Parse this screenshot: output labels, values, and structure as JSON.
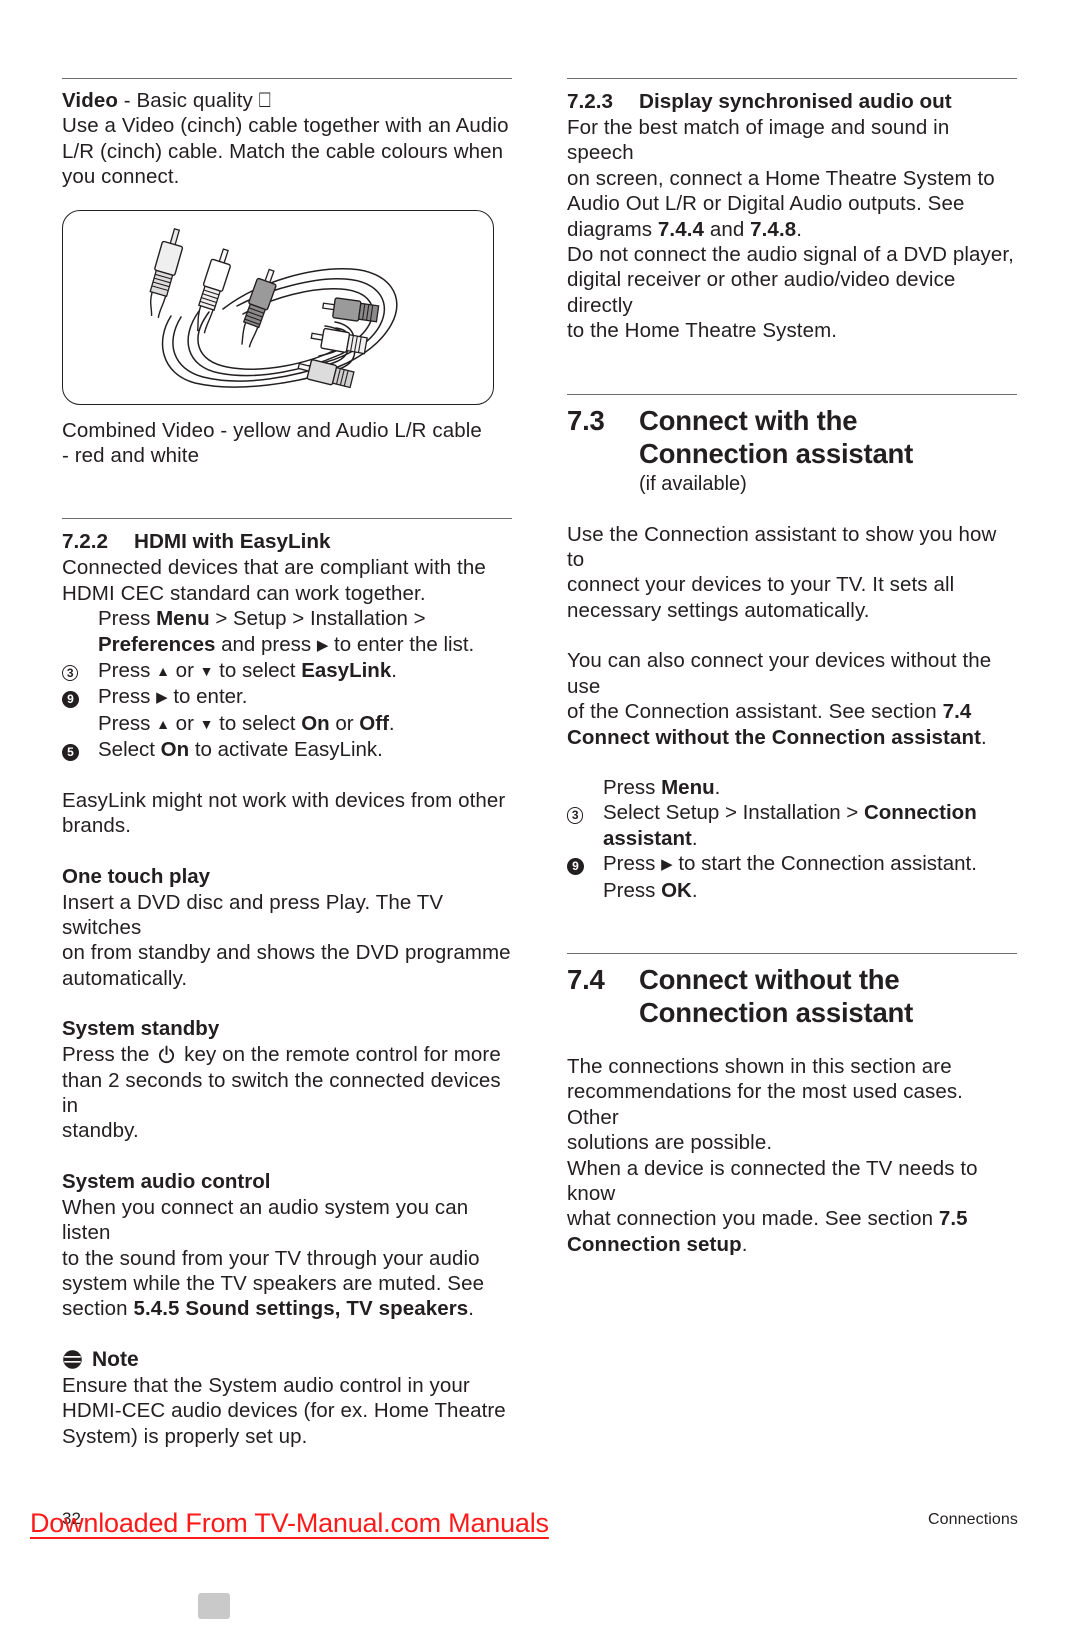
{
  "document": {
    "page_number": "32",
    "footer_right": "Connections",
    "watermark": "Downloaded From TV-Manual.com Manuals",
    "watermark_color": "#ff1a1a"
  },
  "left_column": {
    "video_block": {
      "heading_bold": "Video",
      "heading_rest": " - Basic quality",
      "heading_glyph": "⎕",
      "body": [
        "Use a Video (cinch) cable together with an Audio",
        "L/R (cinch) cable. Match the cable colours when",
        "you connect."
      ],
      "illustration_name": "composite-av-cable",
      "caption": [
        "Combined Video - yellow and Audio L/R cable",
        "- red and white"
      ]
    },
    "hdmi_easylink": {
      "section_number": "7.2.2",
      "section_title": "HDMI with EasyLink",
      "intro": [
        "Connected devices that are compliant with the",
        "HDMI CEC standard can work together."
      ],
      "steps": [
        {
          "marker": "",
          "marker_style": "none",
          "lines": [
            {
              "parts": [
                {
                  "t": "Press ",
                  "b": false
                },
                {
                  "t": "Menu",
                  "b": true
                },
                {
                  "t": " > Setup > Installation >",
                  "b": false
                }
              ]
            },
            {
              "parts": [
                {
                  "t": "Preferences",
                  "b": true
                },
                {
                  "t": " and press ",
                  "b": false
                },
                {
                  "t": "▶",
                  "b": false,
                  "icon": "arrow-right"
                },
                {
                  "t": " to enter the list.",
                  "b": false
                }
              ]
            }
          ]
        },
        {
          "marker": "3",
          "marker_style": "open",
          "lines": [
            {
              "parts": [
                {
                  "t": "Press ",
                  "b": false
                },
                {
                  "t": "▲",
                  "b": false,
                  "icon": "arrow-up"
                },
                {
                  "t": " or ",
                  "b": false
                },
                {
                  "t": "▼",
                  "b": false,
                  "icon": "arrow-down"
                },
                {
                  "t": " to select ",
                  "b": false
                },
                {
                  "t": "EasyLink",
                  "b": true
                },
                {
                  "t": ".",
                  "b": false
                }
              ]
            }
          ]
        },
        {
          "marker": "9",
          "marker_style": "solid",
          "lines": [
            {
              "parts": [
                {
                  "t": "Press ",
                  "b": false
                },
                {
                  "t": "▶",
                  "b": false,
                  "icon": "arrow-right"
                },
                {
                  "t": " to enter.",
                  "b": false
                }
              ]
            },
            {
              "parts": [
                {
                  "t": "Press ",
                  "b": false
                },
                {
                  "t": "▲",
                  "b": false,
                  "icon": "arrow-up"
                },
                {
                  "t": " or ",
                  "b": false
                },
                {
                  "t": "▼",
                  "b": false,
                  "icon": "arrow-down"
                },
                {
                  "t": " to select ",
                  "b": false
                },
                {
                  "t": "On",
                  "b": true
                },
                {
                  "t": " or ",
                  "b": false
                },
                {
                  "t": "Off",
                  "b": true
                },
                {
                  "t": ".",
                  "b": false
                }
              ]
            }
          ]
        },
        {
          "marker": "5",
          "marker_style": "solid",
          "lines": [
            {
              "parts": [
                {
                  "t": "Select ",
                  "b": false
                },
                {
                  "t": "On",
                  "b": true
                },
                {
                  "t": " to activate EasyLink.",
                  "b": false
                }
              ]
            }
          ]
        }
      ],
      "outro": [
        "EasyLink might not work with devices from other",
        "brands."
      ]
    },
    "one_touch_play": {
      "heading": "One touch play",
      "body": [
        "Insert a DVD disc and press Play. The TV switches",
        "on from standby and shows the DVD programme",
        "automatically."
      ]
    },
    "system_standby": {
      "heading": "System standby",
      "body_pre": "Press the ",
      "body_icon": "power-icon",
      "body_post": [
        " key on the remote control for more",
        "than 2 seconds to switch the connected devices in",
        "standby."
      ]
    },
    "system_audio_control": {
      "heading": "System audio control",
      "body": [
        {
          "parts": [
            {
              "t": "When you connect an audio system you can listen",
              "b": false
            }
          ]
        },
        {
          "parts": [
            {
              "t": "to the sound from your TV through your audio",
              "b": false
            }
          ]
        },
        {
          "parts": [
            {
              "t": "system while the TV speakers are muted. See",
              "b": false
            }
          ]
        },
        {
          "parts": [
            {
              "t": "section ",
              "b": false
            },
            {
              "t": "5.4.5 Sound settings, TV speakers",
              "b": true
            },
            {
              "t": ".",
              "b": false
            }
          ]
        }
      ]
    },
    "note": {
      "icon": "note-icon",
      "label": "Note",
      "body": [
        "Ensure that the System audio control in your",
        "HDMI-CEC audio devices (for ex. Home Theatre",
        "System) is properly set up."
      ]
    }
  },
  "right_column": {
    "display_sync": {
      "section_number": "7.2.3",
      "section_title": "Display synchronised audio out",
      "body": [
        {
          "parts": [
            {
              "t": "For the best match of image and sound in speech",
              "b": false
            }
          ]
        },
        {
          "parts": [
            {
              "t": "on screen, connect a Home Theatre System to",
              "b": false
            }
          ]
        },
        {
          "parts": [
            {
              "t": "Audio Out L/R or Digital Audio outputs. See",
              "b": false
            }
          ]
        },
        {
          "parts": [
            {
              "t": "diagrams ",
              "b": false
            },
            {
              "t": "7.4.4",
              "b": true
            },
            {
              "t": " and ",
              "b": false
            },
            {
              "t": "7.4.8",
              "b": true
            },
            {
              "t": ".",
              "b": false
            }
          ]
        },
        {
          "parts": [
            {
              "t": "Do not connect the audio signal of a DVD player,",
              "b": false
            }
          ]
        },
        {
          "parts": [
            {
              "t": "digital receiver or other audio/video device directly",
              "b": false
            }
          ]
        },
        {
          "parts": [
            {
              "t": "to the Home Theatre System.",
              "b": false
            }
          ]
        }
      ]
    },
    "connect_with": {
      "section_number": "7.3",
      "section_title": "Connect with the\nConnection assistant",
      "subtitle": "(if available)",
      "body_1": [
        "Use the Connection assistant to show you how to",
        "connect your devices to your TV. It sets all",
        "necessary settings automatically."
      ],
      "body_2": [
        {
          "parts": [
            {
              "t": "You can also connect your devices without the use",
              "b": false
            }
          ]
        },
        {
          "parts": [
            {
              "t": "of the Connection assistant. See section ",
              "b": false
            },
            {
              "t": "7.4",
              "b": true
            }
          ]
        },
        {
          "parts": [
            {
              "t": "Connect without the Connection assistant",
              "b": true
            },
            {
              "t": ".",
              "b": false
            }
          ]
        }
      ],
      "steps": [
        {
          "marker": "",
          "marker_style": "none",
          "lines": [
            {
              "parts": [
                {
                  "t": "Press ",
                  "b": false
                },
                {
                  "t": "Menu",
                  "b": true
                },
                {
                  "t": ".",
                  "b": false
                }
              ]
            }
          ]
        },
        {
          "marker": "3",
          "marker_style": "open",
          "lines": [
            {
              "parts": [
                {
                  "t": "Select Setup > Installation > ",
                  "b": false
                },
                {
                  "t": "Connection",
                  "b": true
                }
              ]
            },
            {
              "parts": [
                {
                  "t": "assistant",
                  "b": true
                },
                {
                  "t": ".",
                  "b": false
                }
              ]
            }
          ]
        },
        {
          "marker": "9",
          "marker_style": "solid",
          "lines": [
            {
              "parts": [
                {
                  "t": "Press ",
                  "b": false
                },
                {
                  "t": "▶",
                  "b": false,
                  "icon": "arrow-right"
                },
                {
                  "t": " to start the Connection assistant.",
                  "b": false
                }
              ]
            },
            {
              "parts": [
                {
                  "t": "Press ",
                  "b": false
                },
                {
                  "t": "OK",
                  "b": true
                },
                {
                  "t": ".",
                  "b": false
                }
              ]
            }
          ]
        }
      ]
    },
    "connect_without": {
      "section_number": "7.4",
      "section_title": "Connect without the\nConnection assistant",
      "body": [
        {
          "parts": [
            {
              "t": "The connections shown in this section are",
              "b": false
            }
          ]
        },
        {
          "parts": [
            {
              "t": "recommendations for the most used cases. Other",
              "b": false
            }
          ]
        },
        {
          "parts": [
            {
              "t": "solutions are possible.",
              "b": false
            }
          ]
        },
        {
          "parts": [
            {
              "t": "When a device is connected the TV needs to know",
              "b": false
            }
          ]
        },
        {
          "parts": [
            {
              "t": "what connection you made. See section ",
              "b": false
            },
            {
              "t": "7.5",
              "b": true
            }
          ]
        },
        {
          "parts": [
            {
              "t": "Connection setup",
              "b": true
            },
            {
              "t": ".",
              "b": false
            }
          ]
        }
      ]
    }
  }
}
